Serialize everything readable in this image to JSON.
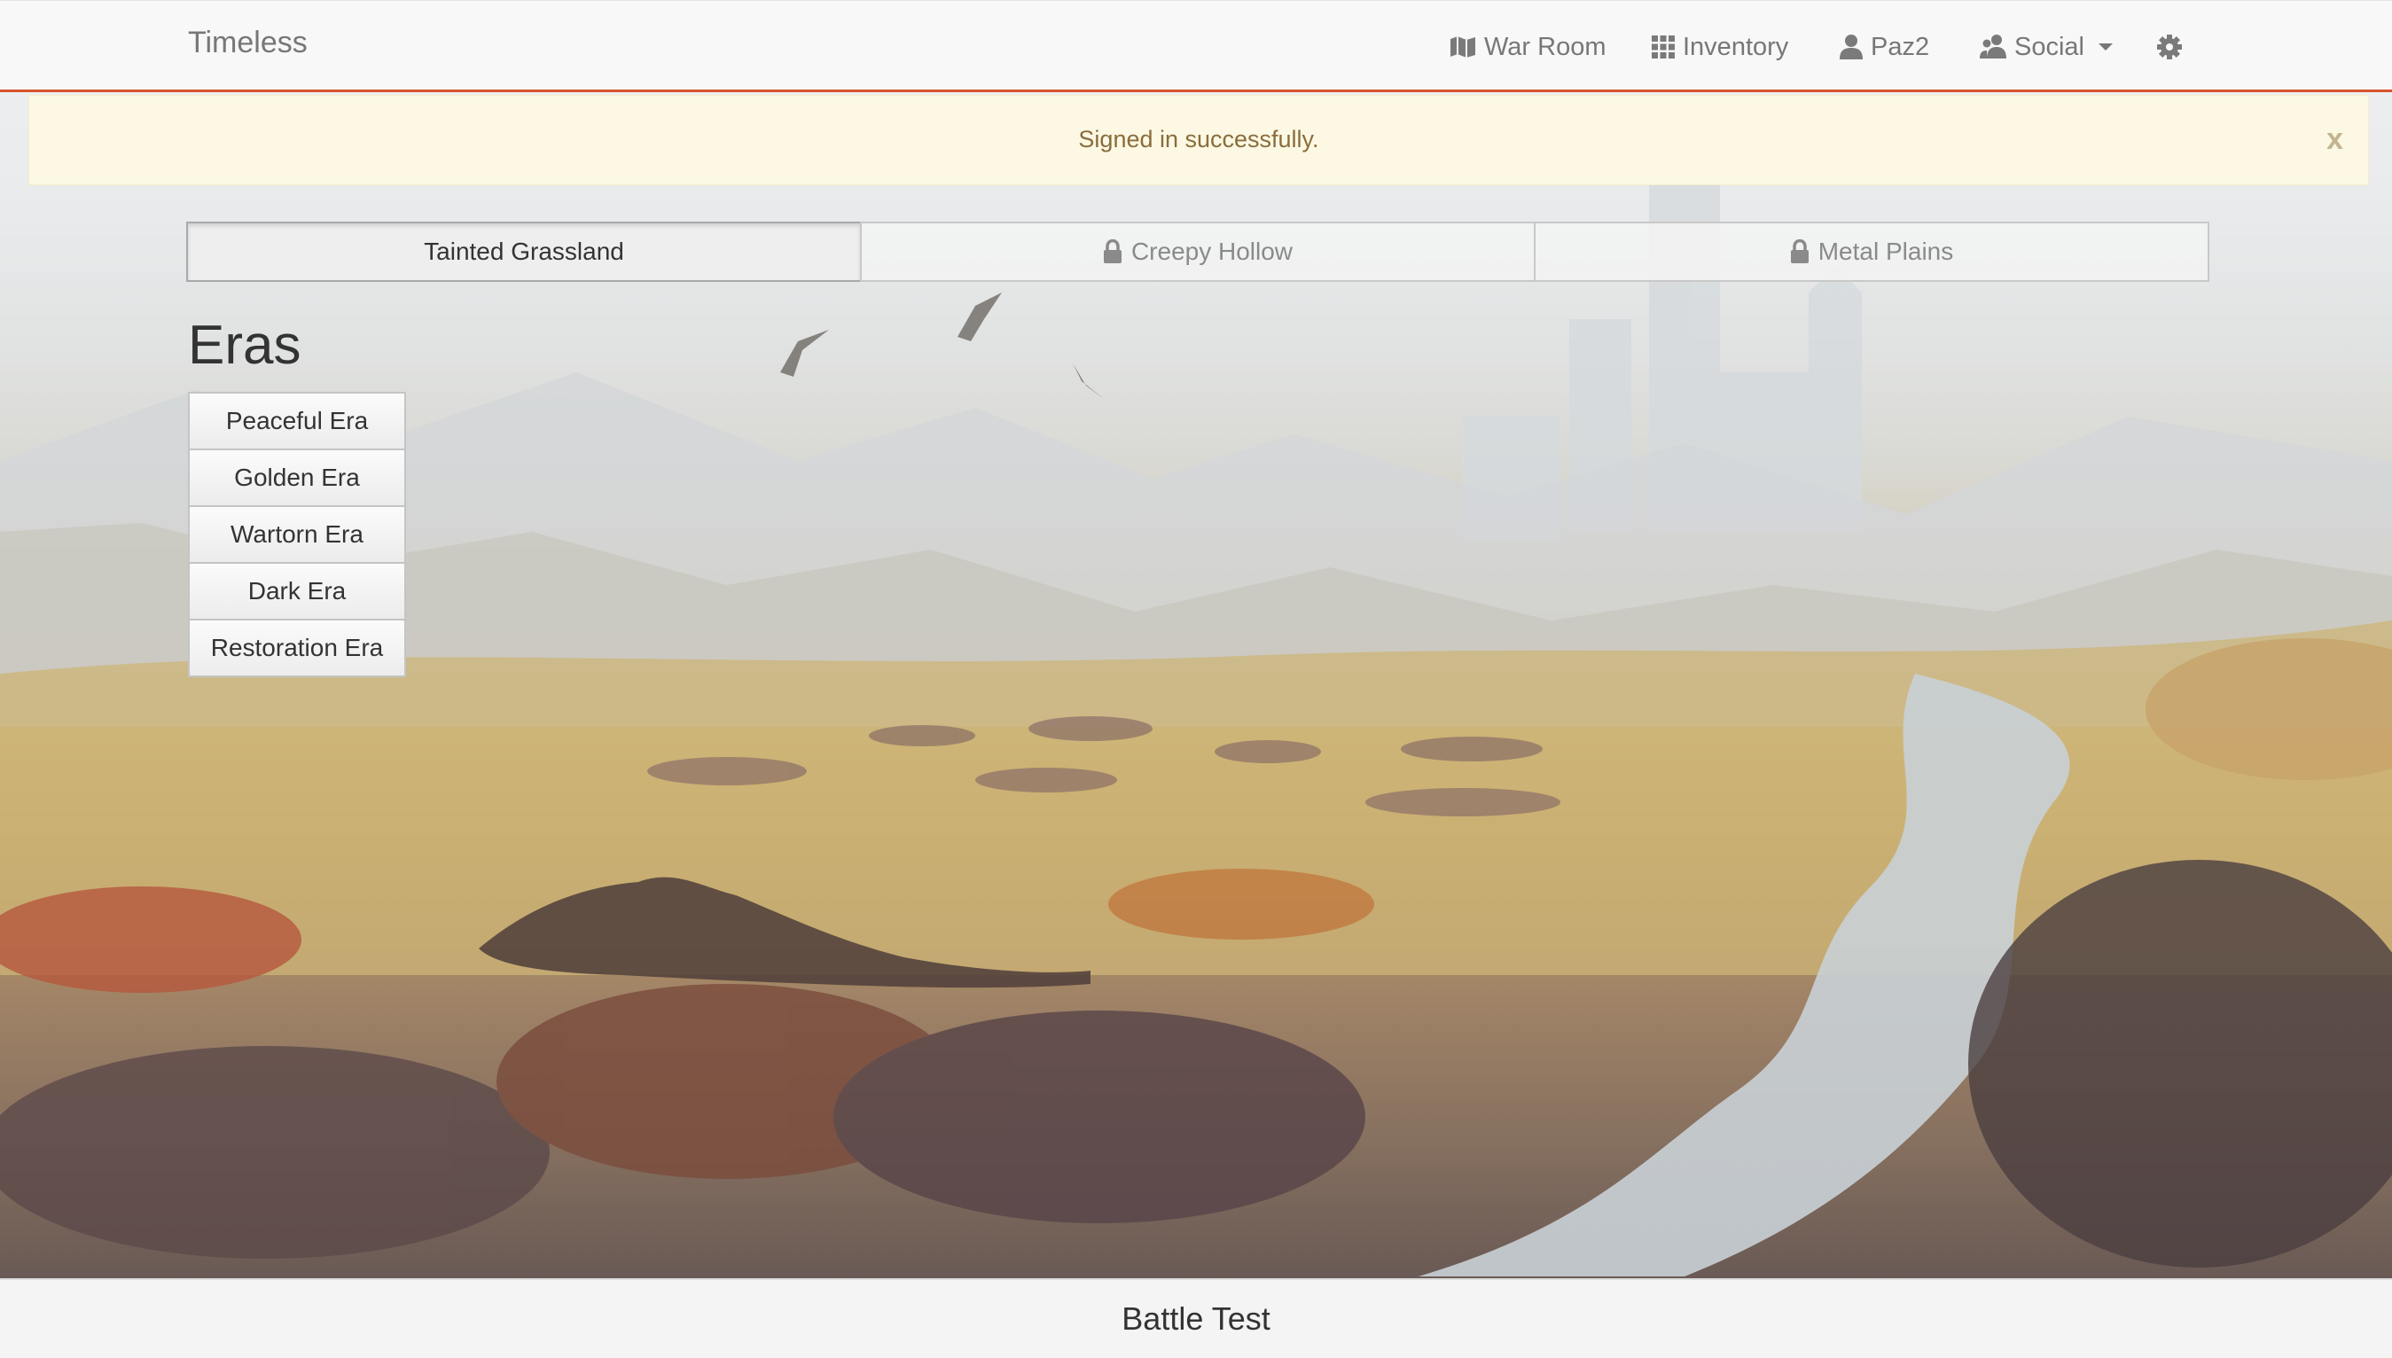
{
  "navbar": {
    "brand": "Timeless",
    "items": [
      {
        "label": "War Room",
        "icon": "map-flag-icon"
      },
      {
        "label": "Inventory",
        "icon": "grid-icon"
      },
      {
        "label": "Paz2",
        "icon": "user-icon"
      },
      {
        "label": "Social",
        "icon": "users-icon"
      }
    ],
    "settings_icon": "gear-icon",
    "accent_color": "#d9532c"
  },
  "alert": {
    "message": "Signed in successfully.",
    "close_label": "x"
  },
  "regions": [
    {
      "label": "Tainted Grassland",
      "locked": false,
      "active": true
    },
    {
      "label": "Creepy Hollow",
      "locked": true,
      "active": false
    },
    {
      "label": "Metal Plains",
      "locked": true,
      "active": false
    }
  ],
  "eras": {
    "title": "Eras",
    "items": [
      "Peaceful Era",
      "Golden Era",
      "Wartorn Era",
      "Dark Era",
      "Restoration Era"
    ]
  },
  "footer": {
    "label": "Battle Test"
  }
}
